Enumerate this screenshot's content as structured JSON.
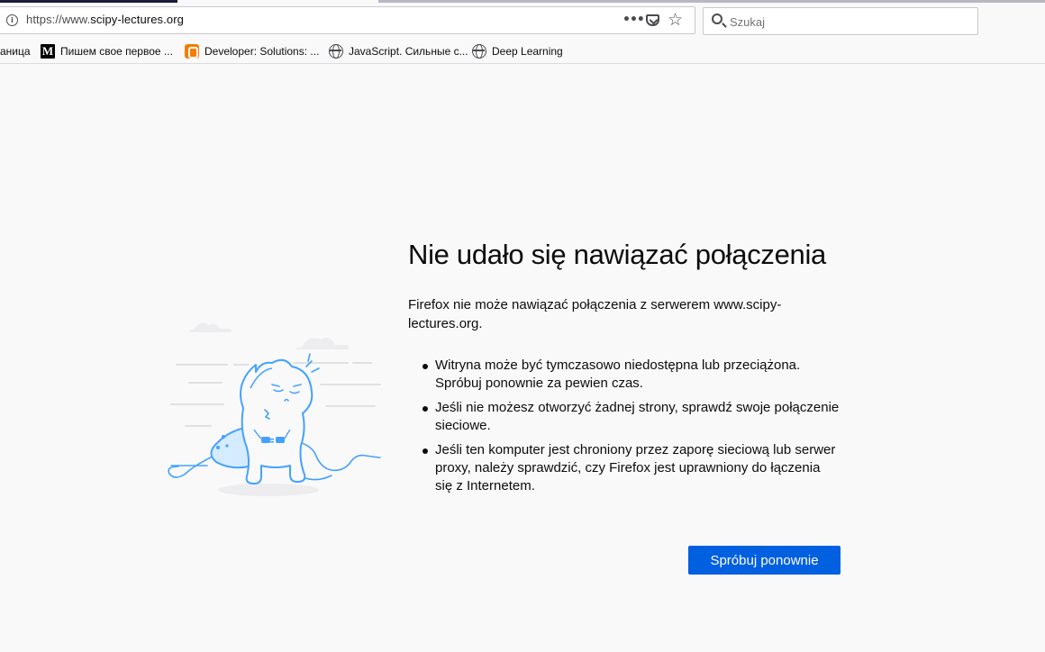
{
  "browser": {
    "url": {
      "prefix": "https://www.",
      "host": "scipy-lectures.org"
    },
    "page_actions_label": "•••",
    "search": {
      "placeholder": "Szukaj",
      "value": ""
    },
    "bookmarks": [
      {
        "label": "аница",
        "icon": "none"
      },
      {
        "label": "Пишем свое первое ...",
        "icon": "medium-icon",
        "icon_glyph": "M"
      },
      {
        "label": "Developer: Solutions: ...",
        "icon": "blogger-icon"
      },
      {
        "label": "JavaScript. Сильные с...",
        "icon": "globe-icon"
      },
      {
        "label": "Deep Learning",
        "icon": "globe-icon"
      }
    ]
  },
  "error_page": {
    "title": "Nie udało się nawiązać połączenia",
    "description": "Firefox nie może nawiązać połączenia z serwerem www.scipy-lectures.org.",
    "reasons": [
      "Witryna może być tymczasowo niedostępna lub przeciążona. Spróbuj ponownie za pewien czas.",
      "Jeśli nie możesz otworzyć żadnej strony, sprawdź swoje połączenie sieciowe.",
      "Jeśli ten komputer jest chroniony przez zaporę sieciową lub serwer proxy, należy sprawdzić, czy Firefox jest uprawniony do łączenia się z Internetem."
    ],
    "try_again_label": "Spróbuj ponownie"
  },
  "colors": {
    "accent_button": "#0060df",
    "illustration_stroke": "#45a1ff",
    "illustration_fill": "#d5ebff",
    "page_background": "#f9f9fa"
  }
}
